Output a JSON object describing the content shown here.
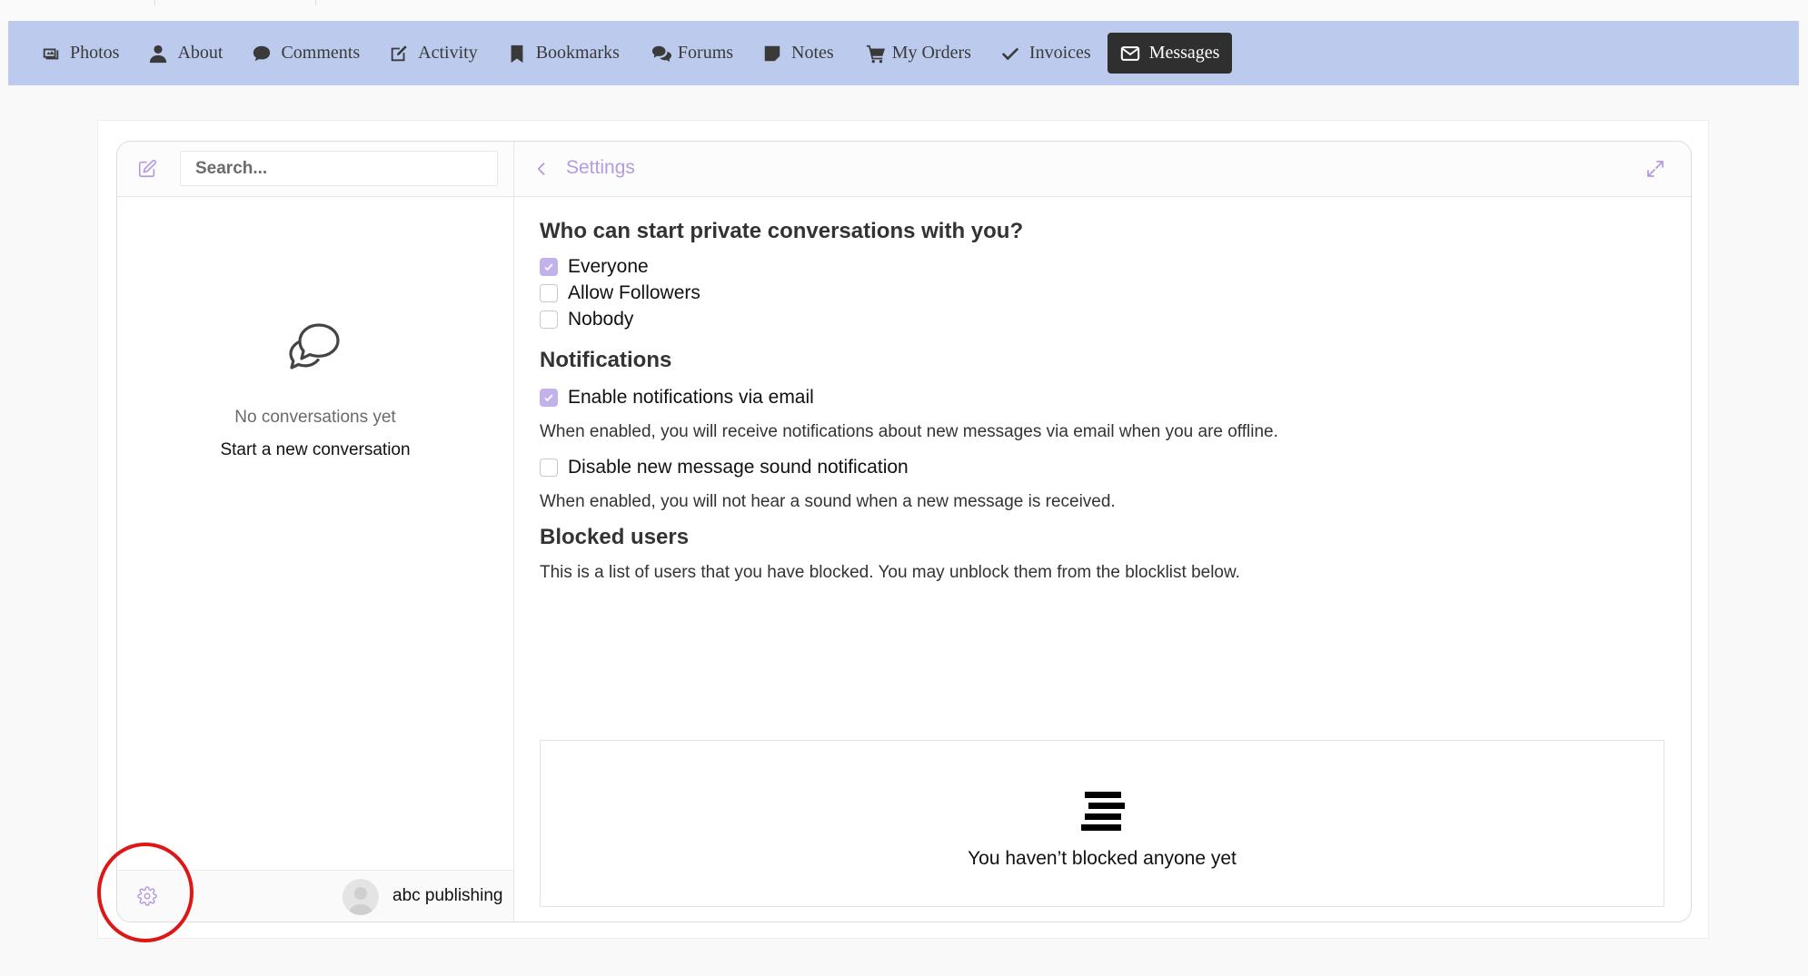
{
  "nav": {
    "items": [
      {
        "label": "Photos",
        "icon": "photos-icon"
      },
      {
        "label": "About",
        "icon": "user-icon"
      },
      {
        "label": "Comments",
        "icon": "comment-icon"
      },
      {
        "label": "Activity",
        "icon": "edit-icon"
      },
      {
        "label": "Bookmarks",
        "icon": "bookmark-icon"
      },
      {
        "label": "Forums",
        "icon": "forums-icon"
      },
      {
        "label": "Notes",
        "icon": "note-icon"
      },
      {
        "label": "My Orders",
        "icon": "cart-icon"
      },
      {
        "label": "Invoices",
        "icon": "check-icon"
      },
      {
        "label": "Messages",
        "icon": "envelope-icon",
        "active": true
      }
    ]
  },
  "header": {
    "search_placeholder": "Search...",
    "settings_title": "Settings"
  },
  "sidebar": {
    "empty_title": "No conversations yet",
    "start_link": "Start a new conversation",
    "username": "abc publishing"
  },
  "settings": {
    "privacy_heading": "Who can start private conversations with you?",
    "privacy_options": [
      {
        "label": "Everyone",
        "checked": true
      },
      {
        "label": "Allow Followers",
        "checked": false
      },
      {
        "label": "Nobody",
        "checked": false
      }
    ],
    "notifications_heading": "Notifications",
    "email_label": "Enable notifications via email",
    "email_checked": true,
    "email_desc": "When enabled, you will receive notifications about new messages via email when you are offline.",
    "sound_label": "Disable new message sound notification",
    "sound_checked": false,
    "sound_desc": "When enabled, you will not hear a sound when a new message is received.",
    "blocked_heading": "Blocked users",
    "blocked_desc": "This is a list of users that you have blocked. You may unblock them from the blocklist below.",
    "blocked_empty": "You haven’t blocked anyone yet"
  },
  "colors": {
    "nav_bg": "#bccbed",
    "accent": "#c3b1ec",
    "highlight": "#dd1717"
  }
}
